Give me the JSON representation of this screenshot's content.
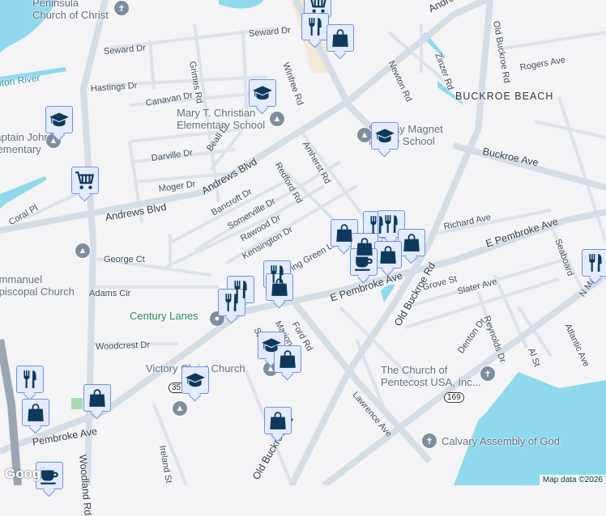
{
  "map": {
    "colors": {
      "background": "#f4f3f5",
      "water": "#8fd9ec",
      "road_major": "#d5dde6",
      "road_minor": "#dde3ea",
      "marker_bg": "#e3ebfd",
      "marker_border": "#6d92dc",
      "marker_icon": "#0d3a5c"
    },
    "streets": [
      "Andrews Blvd",
      "Andrews Blvd",
      "Andrews Blvd",
      "E Pembroke Ave",
      "E Pembroke Ave",
      "Pembroke Ave",
      "Old Buckroe Rd",
      "Old Buckroe Rd",
      "Old Buckroe Rd",
      "Buckroe Ave",
      "Seward Dr",
      "Seward Dr",
      "Hastings Dr",
      "Canavan Dr",
      "Grimes Rd",
      "Winfree Rd",
      "Darville Dr",
      "Beall Dr",
      "Moger Dr",
      "Bancroft Dr",
      "Somerville Dr",
      "Rawood Dr",
      "Kensington Dr",
      "Redford Rd",
      "Amherst Rd",
      "Newton Rd",
      "Zinzer Rd",
      "Rogers Ave",
      "Richard Ave",
      "Grove St",
      "Slater Ave",
      "Reynolds Dr",
      "Denton Dr",
      "Al St",
      "Atlantic Ave",
      "Lawrence Ave",
      "Ford Rd",
      "Marion Rd",
      "George Ct",
      "Adams Cir",
      "Woodcrest Dr",
      "Coral Pl",
      "Ireland St",
      "Woodland Rd",
      "Seaboard",
      "N Mallory",
      "Spring Green Ln",
      "Stuart"
    ],
    "water_labels": [
      "Hampton River"
    ],
    "area_labels": [
      "BUCKROE BEACH"
    ],
    "pois": [
      "Peninsula\nChurch of Christ",
      "Mary T. Christian\nElementary School",
      "Captain John\nElementary",
      "Lindsay Magnet\nMiddle School",
      "Emmanuel\nEpiscopal Church",
      "Century Lanes",
      "Victory Christ Church",
      "The Church of\nPentecost USA, Inc...",
      "Calvary Assembly of God"
    ],
    "route_shields": [
      "351",
      "169"
    ],
    "markers": [
      "shopping-cart",
      "restaurant",
      "shopping-bag",
      "school",
      "school",
      "shopping-cart",
      "school",
      "shopping-bag",
      "restaurant",
      "restaurant",
      "shopping-bag",
      "shopping-bag",
      "shopping-bag",
      "coffee",
      "restaurant",
      "shopping-bag",
      "restaurant",
      "restaurant",
      "restaurant",
      "school",
      "shopping-bag",
      "school",
      "restaurant",
      "shopping-bag",
      "shopping-bag",
      "shopping-bag",
      "coffee"
    ],
    "attribution": "Map data ©2026",
    "logo": "Google"
  }
}
